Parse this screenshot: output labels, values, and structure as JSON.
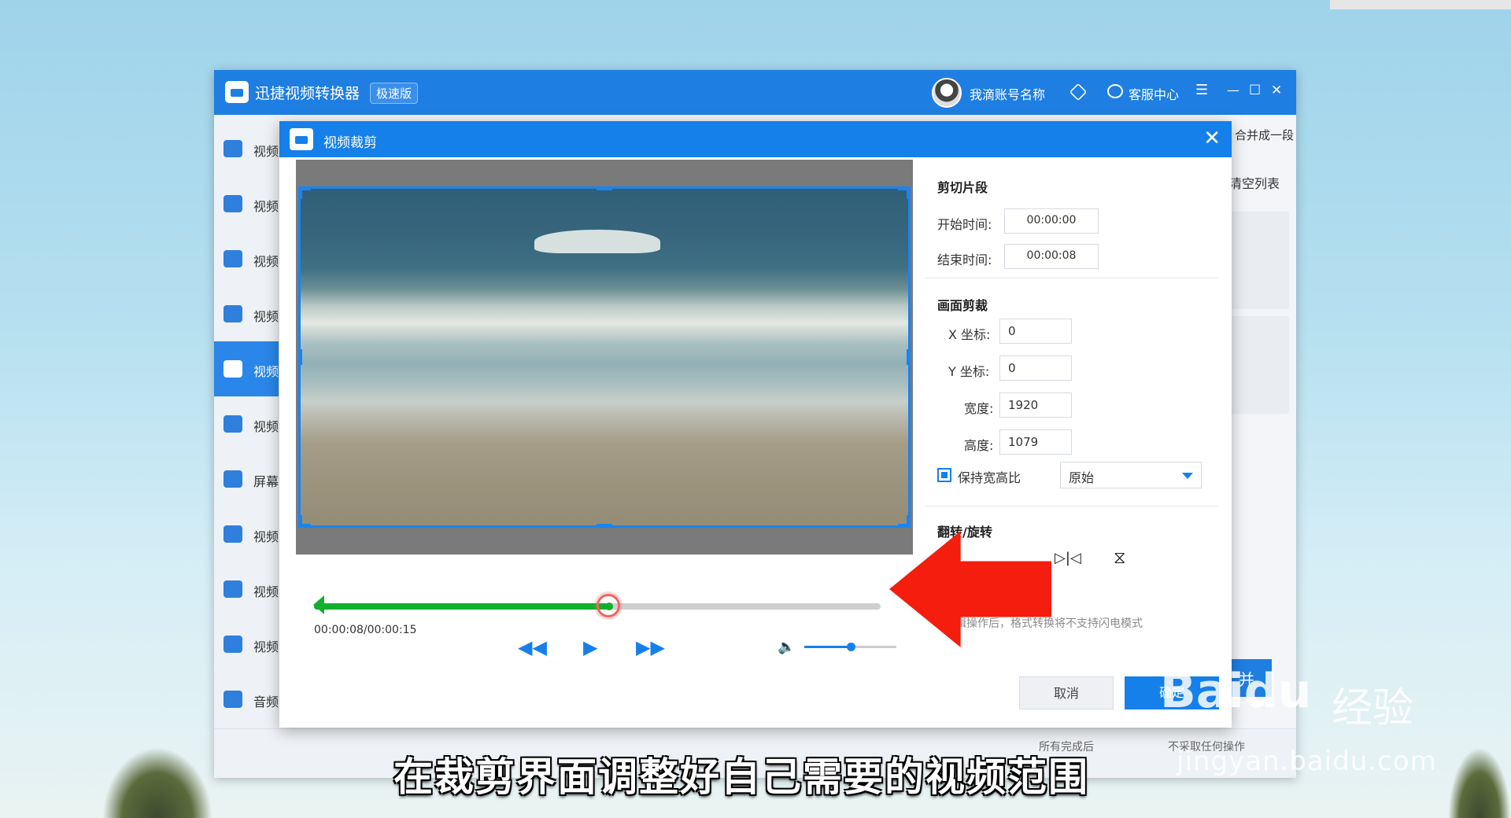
{
  "app": {
    "title": "迅捷视频转换器",
    "badge": "极速版",
    "account_name": "我滴账号名称",
    "service_label": "客服中心",
    "menu_icon": "☰",
    "minimize": "—",
    "maximize": "☐",
    "close": "✕",
    "sidebar": [
      {
        "label": "视频"
      },
      {
        "label": "视频"
      },
      {
        "label": "视频"
      },
      {
        "label": "视频"
      },
      {
        "label": "视频",
        "active": true
      },
      {
        "label": "视频"
      },
      {
        "label": "屏幕"
      },
      {
        "label": "视频"
      },
      {
        "label": "视频"
      },
      {
        "label": "视频"
      },
      {
        "label": "音频"
      }
    ],
    "right_merge_label": "合并成一段",
    "right_clear_label": "清空列表",
    "merge_button": "并",
    "bottom_after_label": "所有完成后",
    "bottom_action_label": "不采取任何操作"
  },
  "dialog": {
    "title": "视频裁剪",
    "close": "✕",
    "player": {
      "time": "00:00:08/00:00:15",
      "progress": 0.52,
      "volume": 0.5,
      "rewind": "◀◀",
      "play": "▶",
      "forward": "▶▶",
      "volume_icon": "🔈"
    },
    "segment": {
      "title": "剪切片段",
      "start_label": "开始时间:",
      "start_value": "00:00:00",
      "end_label": "结束时间:",
      "end_value": "00:00:08"
    },
    "crop": {
      "title": "画面剪裁",
      "x_label": "X 坐标:",
      "x_value": "0",
      "y_label": "Y 坐标:",
      "y_value": "0",
      "width_label": "宽度:",
      "width_value": "1920",
      "height_label": "高度:",
      "height_value": "1079",
      "keep_ratio_label": "保持宽高比",
      "ratio_value": "原始"
    },
    "rotate": {
      "title": "翻转/旋转",
      "flip_h_icon": "▷|◁",
      "flip_v_icon": "⧖"
    },
    "note": "编辑操作后，格式转换将不支持闪电模式",
    "cancel": "取消",
    "ok": "确定"
  },
  "overlay": {
    "subtitle": "在裁剪界面调整好自己需要的视频范围",
    "watermark_logo": "Baidu",
    "watermark_cn": "经验",
    "watermark_url": "jingyan.baidu.com"
  },
  "colors": {
    "titlebar": "#1f7ee2",
    "dialog_titlebar": "#1580ea",
    "progress": "#0fb02c",
    "arrow": "#f41d0e"
  }
}
